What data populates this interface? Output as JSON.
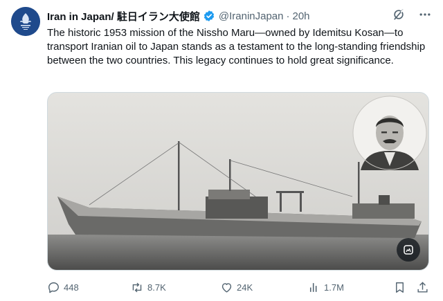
{
  "tweet": {
    "author": {
      "display_name": "Iran in Japan/ 駐日イラン大使館",
      "handle": "@IraninJapan",
      "separator": "·",
      "time": "20h",
      "verified": true,
      "avatar_icon": "embassy-emblem-icon"
    },
    "text": "The historic 1953 mission of the Nissho Maru—owned by Idemitsu Kosan—to transport Iranian oil to Japan stands as a testament to the long-standing friendship between the two countries. This legacy continues to hold great significance.",
    "media": {
      "description_icon": "ship-photo",
      "inset_icon": "portrait-photo",
      "edit_icon": "image-edit-icon"
    },
    "stats": {
      "replies": "448",
      "retweets": "8.7K",
      "likes": "24K",
      "views": "1.7M"
    },
    "icons": {
      "grok": "grok-icon",
      "more": "more-icon",
      "reply": "reply-icon",
      "retweet": "retweet-icon",
      "like": "heart-icon",
      "views": "views-icon",
      "bookmark": "bookmark-icon",
      "share": "share-icon"
    },
    "colors": {
      "verified_badge": "#1d9bf0",
      "secondary_text": "#536471",
      "primary_text": "#0f1419",
      "avatar_bg": "#1f4a8c"
    }
  }
}
